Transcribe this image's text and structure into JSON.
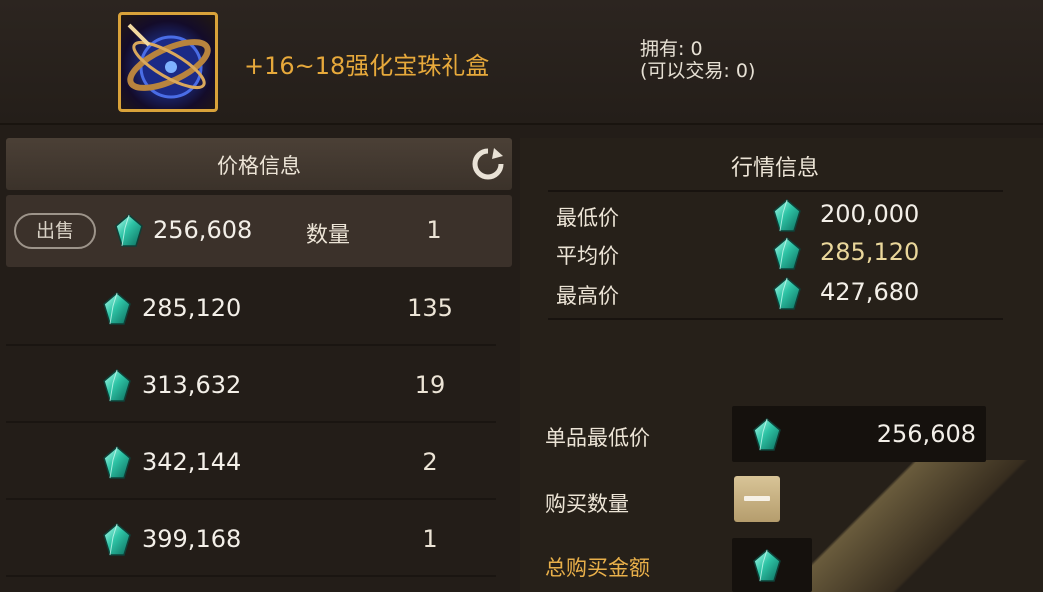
{
  "item": {
    "name": "+16~18强化宝珠礼盒",
    "own_line": "拥有: 0",
    "trade_line": "(可以交易: 0)"
  },
  "price_panel": {
    "title": "价格信息",
    "sell_label": "出售",
    "qty_label": "数量",
    "first_row": {
      "price": "256,608",
      "qty": "1"
    },
    "rows": [
      {
        "price": "285,120",
        "qty": "135"
      },
      {
        "price": "313,632",
        "qty": "19"
      },
      {
        "price": "342,144",
        "qty": "2"
      },
      {
        "price": "399,168",
        "qty": "1"
      }
    ]
  },
  "market_panel": {
    "title": "行情信息",
    "min_label": "最低价",
    "min_value": "200,000",
    "avg_label": "平均价",
    "avg_value": "285,120",
    "max_label": "最高价",
    "max_value": "427,680"
  },
  "buy_panel": {
    "unit_min_label": "单品最低价",
    "unit_min_value": "256,608",
    "qty_label": "购买数量",
    "total_label": "总购买金额"
  },
  "colors": {
    "accent_gold": "#e7a93b",
    "gem_teal": "#2ec4a6"
  }
}
